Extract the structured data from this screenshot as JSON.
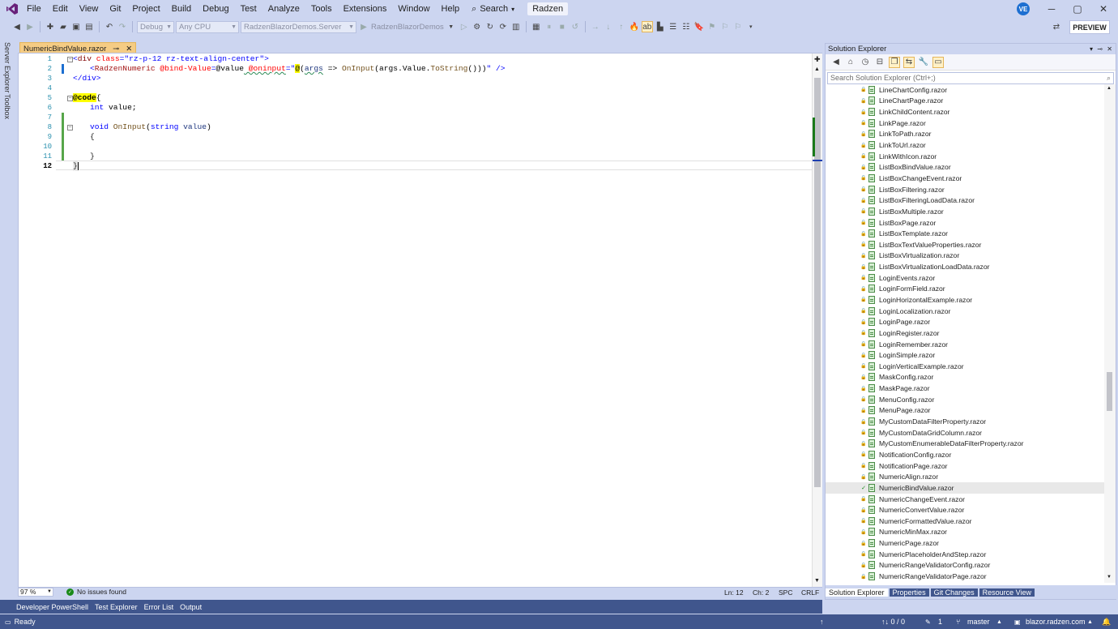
{
  "menubar": {
    "items": [
      "File",
      "Edit",
      "View",
      "Git",
      "Project",
      "Build",
      "Debug",
      "Test",
      "Analyze",
      "Tools",
      "Extensions",
      "Window",
      "Help"
    ],
    "search_label": "Search",
    "search_chevron": "▾",
    "search_icon": "⌕",
    "radzen_label": "Radzen",
    "avatar_initials": "VE",
    "minimize": "─",
    "maximize": "▢",
    "close": "✕"
  },
  "toolbar": {
    "config_combo": "Debug",
    "platform_combo": "Any CPU",
    "project_combo": "RadzenBlazorDemos.Server",
    "run_target": "RadzenBlazorDemos",
    "preview_label": "PREVIEW"
  },
  "left_strip": {
    "server_explorer": "Server Explorer",
    "toolbox": "Toolbox"
  },
  "doc_tab": {
    "title": "NumericBindValue.razor",
    "pin": "⊸",
    "close": "✕"
  },
  "editor": {
    "line_numbers": [
      "1",
      "2",
      "3",
      "4",
      "5",
      "6",
      "7",
      "8",
      "9",
      "10",
      "11",
      "12"
    ],
    "line1": {
      "open": "<",
      "tag": "div",
      "attr": " class",
      "eq": "=",
      "val": "\"rz-p-12 rz-text-align-center\"",
      "close": ">"
    },
    "line2": {
      "open": "<",
      "tag": "RadzenNumeric",
      "attr1": " @bind-Value",
      "eq1": "=",
      "val1": "@value",
      "attr2": " @oninput",
      "eq2": "=",
      "val2": "\"",
      "at": "@",
      "expr1": "(",
      "par": "args",
      "expr2": " => ",
      "meth": "OnInput",
      "expr3": "(args.Value.",
      "meth2": "ToString",
      "expr4": "()))",
      "val3": "\"",
      "selfclose": " />"
    },
    "line3": {
      "text": "</div>"
    },
    "line5": {
      "directive": "@code",
      "brace": "{"
    },
    "line6": {
      "kw": "int",
      "rest": " value;"
    },
    "line8": {
      "kw": "void",
      "meth": "OnInput",
      "p1": "(",
      "kw2": "string",
      "par": " value",
      "p2": ")"
    },
    "line9": {
      "text": "{"
    },
    "line11": {
      "text": "}"
    },
    "line12": {
      "text": "}"
    }
  },
  "editor_status": {
    "zoom": "97 %",
    "issues": "No issues found",
    "ln": "Ln: 12",
    "ch": "Ch: 2",
    "spc": "SPC",
    "crlf": "CRLF"
  },
  "bottom_tabs": [
    "Developer PowerShell",
    "Test Explorer",
    "Error List",
    "Output"
  ],
  "solution_explorer": {
    "title": "Solution Explorer",
    "title_controls": {
      "pin": "⊸",
      "arrow": "▾",
      "close": "✕"
    },
    "search_placeholder": "Search Solution Explorer (Ctrl+;)",
    "items": [
      "LineChartConfig.razor",
      "LineChartPage.razor",
      "LinkChildContent.razor",
      "LinkPage.razor",
      "LinkToPath.razor",
      "LinkToUrl.razor",
      "LinkWithIcon.razor",
      "ListBoxBindValue.razor",
      "ListBoxChangeEvent.razor",
      "ListBoxFiltering.razor",
      "ListBoxFilteringLoadData.razor",
      "ListBoxMultiple.razor",
      "ListBoxPage.razor",
      "ListBoxTemplate.razor",
      "ListBoxTextValueProperties.razor",
      "ListBoxVirtualization.razor",
      "ListBoxVirtualizationLoadData.razor",
      "LoginEvents.razor",
      "LoginFormField.razor",
      "LoginHorizontalExample.razor",
      "LoginLocalization.razor",
      "LoginPage.razor",
      "LoginRegister.razor",
      "LoginRemember.razor",
      "LoginSimple.razor",
      "LoginVerticalExample.razor",
      "MaskConfig.razor",
      "MaskPage.razor",
      "MenuConfig.razor",
      "MenuPage.razor",
      "MyCustomDataFilterProperty.razor",
      "MyCustomDataGridColumn.razor",
      "MyCustomEnumerableDataFilterProperty.razor",
      "NotificationConfig.razor",
      "NotificationPage.razor",
      "NumericAlign.razor",
      "NumericBindValue.razor",
      "NumericChangeEvent.razor",
      "NumericConvertValue.razor",
      "NumericFormattedValue.razor",
      "NumericMinMax.razor",
      "NumericPage.razor",
      "NumericPlaceholderAndStep.razor",
      "NumericRangeValidatorConfig.razor",
      "NumericRangeValidatorPage.razor"
    ],
    "selected_item": "NumericBindValue.razor",
    "tabs": [
      "Solution Explorer",
      "Properties",
      "Git Changes",
      "Resource View"
    ]
  },
  "statusbar": {
    "ready": "Ready",
    "sync": "↑↓ 0 / 0",
    "edits": "1",
    "branch": "master",
    "repo": "blazor.radzen.com"
  }
}
